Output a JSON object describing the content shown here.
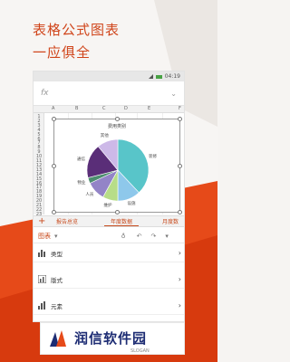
{
  "promo": {
    "line1": "表格公式图表",
    "line2": "一应俱全"
  },
  "status": {
    "time": "04:19"
  },
  "formula": {
    "fx": "fx"
  },
  "sheet": {
    "columns": [
      "A",
      "B",
      "C",
      "D",
      "E",
      "F"
    ],
    "rows": [
      "1",
      "2",
      "3",
      "4",
      "5",
      "6",
      "7",
      "8",
      "9",
      "10",
      "11",
      "12",
      "13",
      "14",
      "15",
      "16",
      "17",
      "18",
      "19",
      "20",
      "21",
      "22",
      "23"
    ]
  },
  "chart_data": {
    "type": "pie",
    "title": "费用类别",
    "categories": [
      "装修",
      "设施",
      "维护",
      "人员",
      "物业",
      "通信",
      "其他"
    ],
    "values": [
      38,
      12,
      8,
      10,
      3,
      18,
      11
    ],
    "colors": [
      "#58c5c9",
      "#8ec8eb",
      "#b7dd88",
      "#9384c7",
      "#4c8d6e",
      "#5a2e78",
      "#cdb9e8"
    ]
  },
  "tabs": {
    "add": "+",
    "items": [
      "报告总览",
      "年度数据",
      "月度数"
    ]
  },
  "toolbar": {
    "title": "图表"
  },
  "menu": {
    "items": [
      "类型",
      "版式",
      "元素"
    ]
  },
  "brand": {
    "name": "润信软件园",
    "slogan": "SLOGAN",
    "color": "#1d2c73"
  },
  "accent": "#d0451b"
}
